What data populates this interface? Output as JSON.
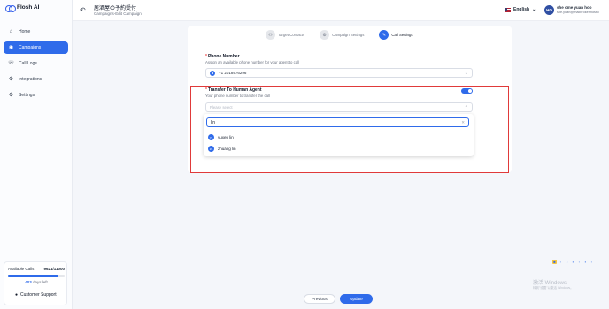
{
  "app": {
    "logo_text": "Flosh AI"
  },
  "sidebar": {
    "items": [
      {
        "label": "Home",
        "icon": "home-icon",
        "glyph": "⌂",
        "active": false
      },
      {
        "label": "Campaigns",
        "icon": "campaign-icon",
        "glyph": "◉",
        "active": true
      },
      {
        "label": "Call Logs",
        "icon": "call-log-icon",
        "glyph": "☏",
        "active": false
      },
      {
        "label": "Integrations",
        "icon": "integrations-icon",
        "glyph": "⚙",
        "active": false
      },
      {
        "label": "Settings",
        "icon": "settings-icon",
        "glyph": "⚙",
        "active": false
      }
    ],
    "usage": {
      "label": "Available Calls",
      "value": "9621/11000",
      "fill_fraction": 0.875,
      "days_value": "403",
      "days_suffix": "days left"
    },
    "support_label": "Customer Support"
  },
  "header": {
    "back_glyph": "↶",
    "title": "居酒屋の予約受付",
    "subtitle": "Campaigns-Edit Campaign",
    "language": "English",
    "user_initials": "HO",
    "user_name": "she ome yuan hoo",
    "user_email": "she.yuan@mailbrokenhost.com"
  },
  "steps": [
    {
      "label": "Target Contacts",
      "glyph": "⚇",
      "active": false
    },
    {
      "label": "Campaign Settings",
      "glyph": "⚙",
      "active": false
    },
    {
      "label": "Call Settings",
      "glyph": "✎",
      "active": true
    }
  ],
  "phone_section": {
    "label": "Phone Number",
    "description": "Assign an available phone number for your agent to call",
    "value": "+1 2018976296",
    "chevron": "⌄"
  },
  "transfer_section": {
    "label": "Transfer To Human Agent",
    "description": "Your phone number to transfer the call",
    "enabled": true,
    "placeholder": "Please select",
    "chevron": "⌄"
  },
  "dropdown": {
    "search_value": "lin",
    "clear_glyph": "✕",
    "options": [
      {
        "label": "yuxen lin",
        "initials": "YL"
      },
      {
        "label": "zhuang lin",
        "initials": "ZL"
      }
    ]
  },
  "footer": {
    "previous_label": "Previous",
    "update_label": "Update"
  },
  "watermark": {
    "line1": "激活 Windows",
    "line2": "转到\"设置\"以激活 Windows。"
  },
  "colors": {
    "accent": "#2f6bea",
    "highlight": "#e03a3a"
  }
}
